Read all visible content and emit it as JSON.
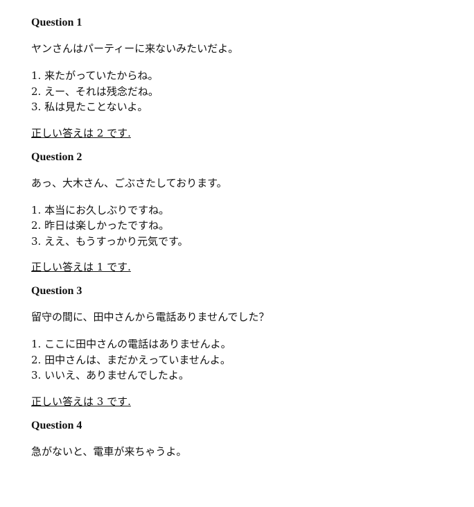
{
  "questions": [
    {
      "heading": "Question 1",
      "prompt": "ヤンさんはパーティーに来ないみたいだよ。",
      "options": [
        "1. 来たがっていたからね。",
        "2. えー、それは残念だね。",
        "3. 私は見たことないよ。"
      ],
      "answer": "正しい答えは 2 です."
    },
    {
      "heading": "Question 2",
      "prompt": "あっ、大木さん、ごぶさたしております。",
      "options": [
        "1. 本当にお久しぶりですね。",
        "2. 昨日は楽しかったですね。",
        "3. ええ、もうすっかり元気です。"
      ],
      "answer": "正しい答えは 1 です."
    },
    {
      "heading": "Question 3",
      "prompt": "留守の間に、田中さんから電話ありませんでした？",
      "options": [
        "1. ここに田中さんの電話はありませんよ。",
        "2. 田中さんは、まだかえっていませんよ。",
        "3. いいえ、ありませんでしたよ。"
      ],
      "answer": "正しい答えは 3 です."
    },
    {
      "heading": "Question 4",
      "prompt": "急がないと、電車が来ちゃうよ。"
    }
  ]
}
